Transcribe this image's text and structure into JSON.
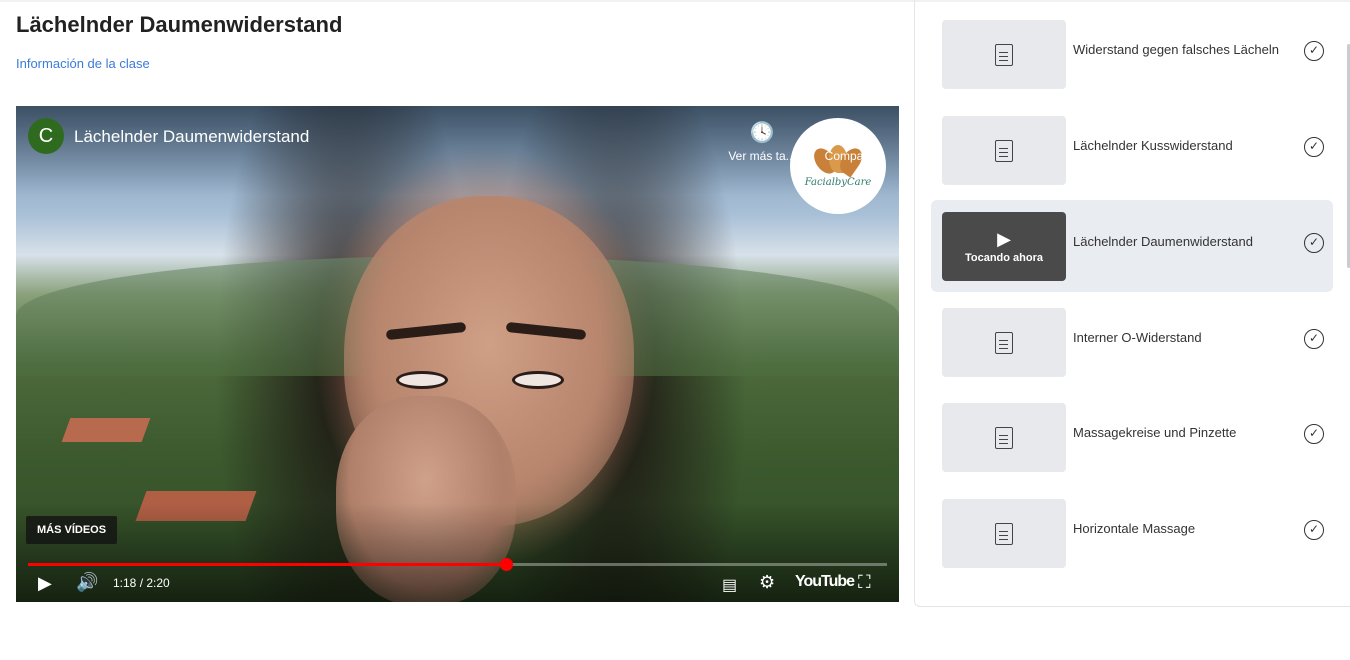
{
  "page": {
    "title": "Lächelnder Daumenwiderstand",
    "class_info_link": "Información de la clase"
  },
  "video": {
    "channel_initial": "C",
    "title": "Lächelnder Daumenwiderstand",
    "watch_later_label": "Ver más ta...",
    "share_label": "Compartir",
    "brand_text": "FacialbyCare",
    "more_videos_label": "MÁS VÍDEOS",
    "time": "1:18 / 2:20",
    "progress": 0.557,
    "youtube_label": "YouTube",
    "progress_color": "#ff0000"
  },
  "sidebar": {
    "now_playing_label": "Tocando ahora",
    "items": [
      {
        "title": "Widerstand gegen falsches Lächeln",
        "active": false,
        "icon": "document-icon",
        "status": "completed"
      },
      {
        "title": "Lächelnder Kusswiderstand",
        "active": false,
        "icon": "document-icon",
        "status": "completed"
      },
      {
        "title": "Lächelnder Daumenwiderstand",
        "active": true,
        "icon": "play-icon",
        "status": "completed"
      },
      {
        "title": "Interner O-Widerstand",
        "active": false,
        "icon": "document-icon",
        "status": "completed"
      },
      {
        "title": "Massagekreise und Pinzette",
        "active": false,
        "icon": "document-icon",
        "status": "completed"
      },
      {
        "title": "Horizontale Massage",
        "active": false,
        "icon": "document-icon",
        "status": "completed"
      }
    ]
  }
}
